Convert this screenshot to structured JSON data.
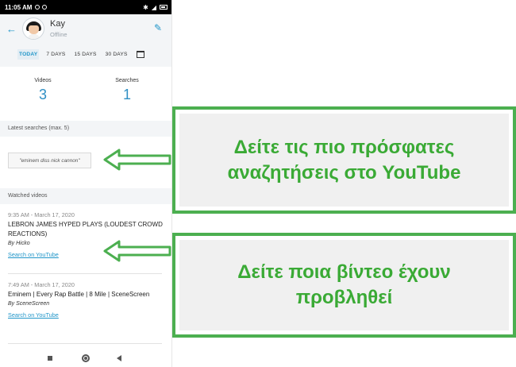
{
  "status_bar": {
    "time": "11:05 AM"
  },
  "profile": {
    "name": "Kay",
    "status": "Offline"
  },
  "tabs": [
    {
      "label": "TODAY",
      "active": true
    },
    {
      "label": "7 DAYS"
    },
    {
      "label": "15 DAYS"
    },
    {
      "label": "30 DAYS"
    }
  ],
  "stats": {
    "videos_label": "Videos",
    "videos_value": "3",
    "searches_label": "Searches",
    "searches_value": "1"
  },
  "latest_searches": {
    "header": "Latest searches (max. 5)",
    "items": [
      "\"eminem diss nick cannon\""
    ]
  },
  "watched_videos": {
    "header": "Watched videos",
    "items": [
      {
        "time": "9:35 AM - March 17, 2020",
        "title": "LEBRON JAMES HYPED PLAYS (LOUDEST CROWD REACTIONS)",
        "by": "By Hicko",
        "link": "Search on YouTube"
      },
      {
        "time": "7:49 AM - March 17, 2020",
        "title": "Eminem | Every Rap Battle | 8 Mile | SceneScreen",
        "by": "By SceneScreen",
        "link": "Search on YouTube"
      }
    ]
  },
  "callouts": {
    "searches": "Δείτε τις πιο πρόσφατες αναζητήσεις στο YouTube",
    "videos": "Δείτε ποια βίντεο έχουν προβληθεί"
  },
  "colors": {
    "accent": "#2196c9",
    "callout_green": "#3aaa35",
    "callout_border": "#4caf50"
  },
  "icons": [
    "back-arrow-icon",
    "edit-pencil-icon",
    "calendar-icon",
    "nav-recents-icon",
    "nav-home-icon",
    "nav-back-icon"
  ]
}
